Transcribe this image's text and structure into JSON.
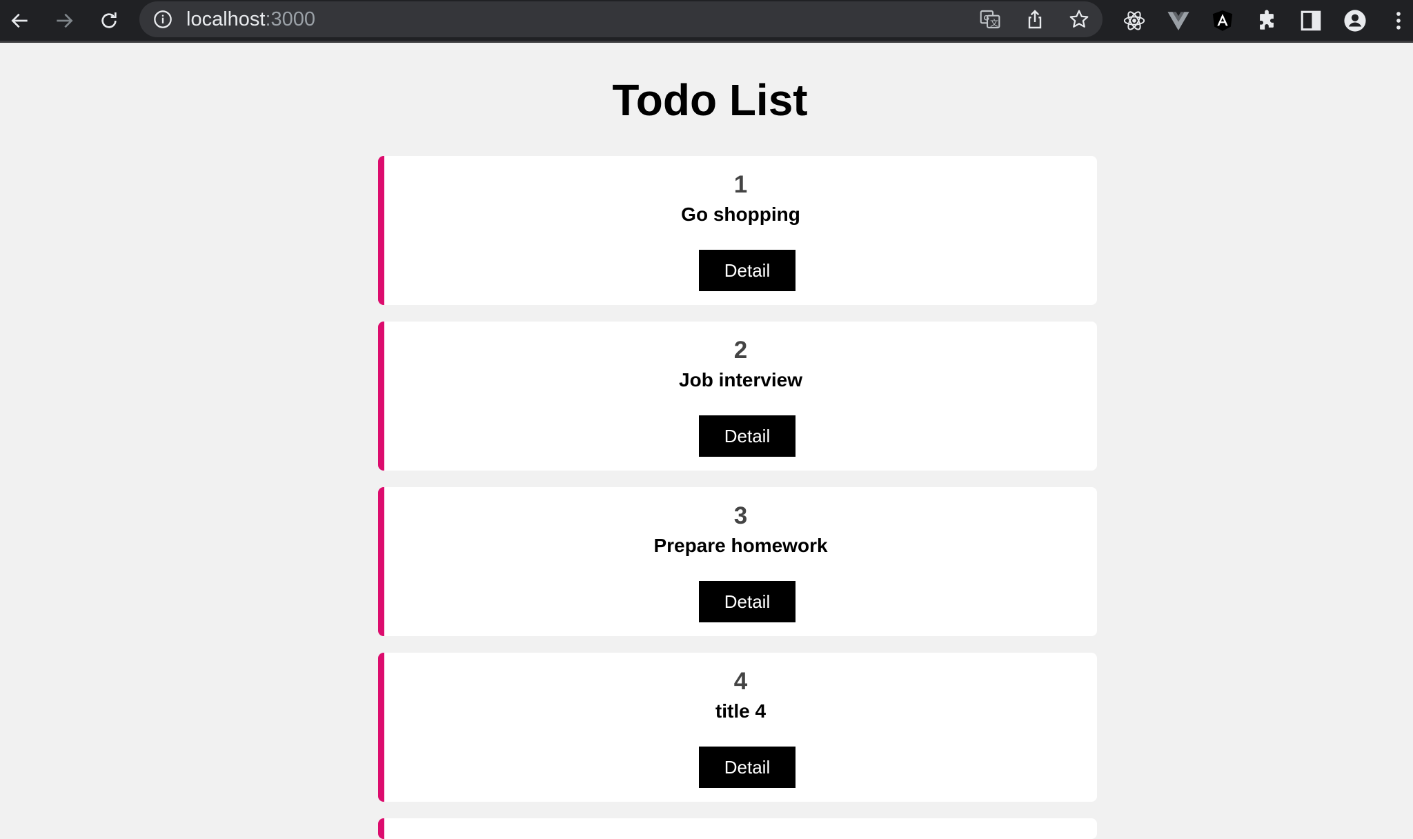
{
  "browser": {
    "url_host": "localhost",
    "url_port": ":3000",
    "icons": {
      "back": "back-arrow-icon",
      "forward": "forward-arrow-icon",
      "reload": "reload-icon",
      "site_info": "info-icon",
      "translate": "translate-icon",
      "share": "share-icon",
      "bookmark": "star-icon",
      "react_devtools": "react-icon",
      "vue_devtools": "vue-icon",
      "angular_devtools": "angular-icon",
      "extensions": "puzzle-icon",
      "side_panel": "side-panel-icon",
      "profile": "profile-icon",
      "menu": "kebab-menu-icon"
    }
  },
  "page": {
    "title": "Todo List"
  },
  "todos": [
    {
      "id": "1",
      "title": "Go shopping",
      "button": "Detail"
    },
    {
      "id": "2",
      "title": "Job interview",
      "button": "Detail"
    },
    {
      "id": "3",
      "title": "Prepare homework",
      "button": "Detail"
    },
    {
      "id": "4",
      "title": "title 4",
      "button": "Detail"
    }
  ],
  "colors": {
    "accent": "#dc0c6d",
    "page_background": "#f1f1f1",
    "toolbar_background": "#202124",
    "button_background": "#000000"
  }
}
